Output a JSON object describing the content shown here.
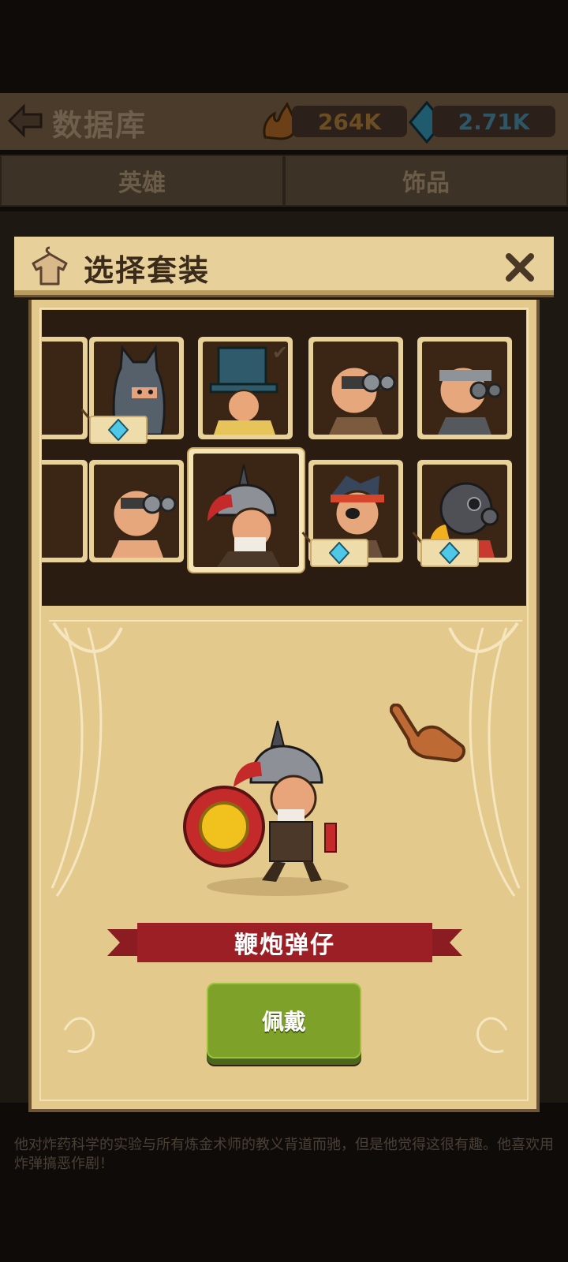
{
  "background": {
    "title": "数据库",
    "gold_amount": "264K",
    "gem_amount": "2.71K",
    "tabs": [
      "英雄",
      "饰品"
    ],
    "description": "他对炸药科学的实验与所有炼金术师的教义背道而驰，但是他觉得这很有趣。他喜欢用炸弹搞恶作剧！"
  },
  "modal": {
    "title": "选择套装",
    "close_icon": "close-icon",
    "header_icon": "shirt-hanger-icon",
    "outfits": [
      {
        "name": "partial-left-top",
        "locked": true,
        "selected": false
      },
      {
        "name": "cat-hood",
        "locked": true,
        "selected": false
      },
      {
        "name": "blue-top-hat",
        "locked": false,
        "selected": false,
        "equipped": true
      },
      {
        "name": "goggles-bald",
        "locked": false,
        "selected": false
      },
      {
        "name": "goggles-headband",
        "locked": false,
        "selected": false
      },
      {
        "name": "partial-left-bottom",
        "locked": false,
        "selected": false
      },
      {
        "name": "goggles-bald-2",
        "locked": false,
        "selected": false
      },
      {
        "name": "firecracker-helmet",
        "locked": false,
        "selected": true
      },
      {
        "name": "eyepatch-pirate",
        "locked": true,
        "selected": false
      },
      {
        "name": "gas-mask",
        "locked": true,
        "selected": false
      }
    ],
    "selected_name": "鞭炮弹仔",
    "wear_label": "佩戴"
  },
  "colors": {
    "panel": "#e4c98d",
    "ribbon": "#9b1f25",
    "button": "#7ea12a",
    "gem": "#4fc7e6"
  }
}
